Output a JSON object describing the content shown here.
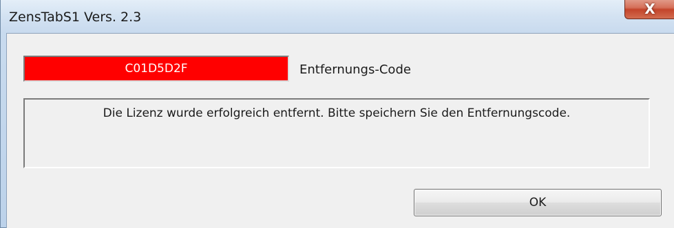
{
  "window": {
    "title": "ZensTabS1 Vers. 2.3",
    "close_symbol": "X"
  },
  "dialog": {
    "removal_code_value": "C01D5D2F",
    "removal_code_label": "Entfernungs-Code",
    "message": "Die Lizenz wurde erfolgreich entfernt. Bitte speichern Sie den Entfernungscode.",
    "ok_label": "OK"
  },
  "colors": {
    "code_field_background": "#ff0000",
    "code_field_text": "#ffffff",
    "dialog_background": "#f0f0f0",
    "close_button": "#c3442b"
  },
  "icons": {
    "close": "close-icon"
  }
}
